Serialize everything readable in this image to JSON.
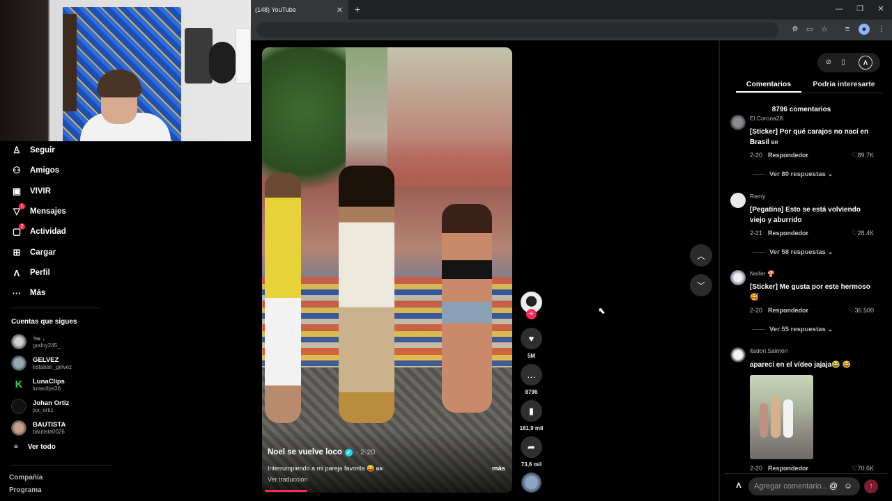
{
  "browser": {
    "tab_title": "(148) YouTube",
    "tab_close": "✕",
    "new_tab": "+",
    "window_controls": [
      "—",
      "❐",
      "✕"
    ],
    "toolbar_icons": [
      "translate-icon",
      "cast-icon",
      "star-icon",
      "queue-icon",
      "profile-icon",
      "menu-icon"
    ]
  },
  "sidebar": {
    "nav": [
      {
        "label": "Seguir",
        "icon": "follow-icon",
        "glyph": "♙",
        "badge": ""
      },
      {
        "label": "Amigos",
        "icon": "friends-icon",
        "glyph": "⚇",
        "badge": ""
      },
      {
        "label": "VIVIR",
        "icon": "live-icon",
        "glyph": "▣",
        "badge": ""
      },
      {
        "label": "Mensajes",
        "icon": "messages-icon",
        "glyph": "▽",
        "badge": "1"
      },
      {
        "label": "Actividad",
        "icon": "activity-icon",
        "glyph": "▢",
        "badge": "2"
      },
      {
        "label": "Cargar",
        "icon": "upload-icon",
        "glyph": "⊞",
        "badge": ""
      },
      {
        "label": "Perfil",
        "icon": "profile-icon",
        "glyph": "Λ",
        "badge": ""
      },
      {
        "label": "Más",
        "icon": "more-icon",
        "glyph": "···",
        "badge": ""
      }
    ],
    "following_header": "Cuentas que sigues",
    "accounts": [
      {
        "name": "🐜 .",
        "handle": "godoy245_"
      },
      {
        "name": "GELVEZ",
        "handle": "estaban_gelvez"
      },
      {
        "name": "LunaClips",
        "handle": "lunaclips36"
      },
      {
        "name": "Johan Ortiz",
        "handle": "jxx_ortiz"
      },
      {
        "name": "BAUTISTA",
        "handle": "bautista0026"
      }
    ],
    "see_all": "Ver todo",
    "footer": {
      "company": "Compañía",
      "program": "Programa"
    }
  },
  "video": {
    "author": "Noel se vuelve loco",
    "date": "· 2-20",
    "description": "Interrumpiendo a mi pareja favorita 😝",
    "description_tag": "BR",
    "more": "más",
    "translate": "Ver traducción",
    "progress": 0.17
  },
  "actions": {
    "likes": "5M",
    "comments": "8796",
    "saves": "181,9 mil",
    "shares": "73,6 mil"
  },
  "panel": {
    "tabs": [
      "Comentarios",
      "Podría interesarte"
    ],
    "count": "8796 comentarios",
    "comments": [
      {
        "user": "El.Corona28.",
        "text": "[Sticker] Por qué carajos no nací en Brasil",
        "tag": "BR",
        "date": "2-20",
        "reply": "Respondedor",
        "likes": "89.7K",
        "replies": "Ver 80 respuestas"
      },
      {
        "user": "Remy",
        "text": "[Pegatina] Esto se está volviendo viejo y aburrido",
        "tag": "",
        "date": "2-21",
        "reply": "Respondedor",
        "likes": "28.4K",
        "replies": "Ver 58 respuestas"
      },
      {
        "user": "Neifer 🍄",
        "text": "[Sticker] Me gusta por este hermoso 🥰",
        "tag": "",
        "date": "2-20",
        "reply": "Respondedor",
        "likes": "36.500",
        "replies": "Ver 55 respuestas"
      },
      {
        "user": "itadori.Salmón",
        "text": "aparecí en el vídeo jajaja😂 😂",
        "tag": "",
        "date": "2-20",
        "reply": "Respondedor",
        "likes": "70.6K",
        "replies": ""
      }
    ],
    "input_placeholder": "Agregar comentario...",
    "at_glyph": "@",
    "emoji_glyph": "☺",
    "send_glyph": "↑"
  },
  "colors": {
    "accent": "#fe2c55",
    "verified": "#20d5ec"
  }
}
